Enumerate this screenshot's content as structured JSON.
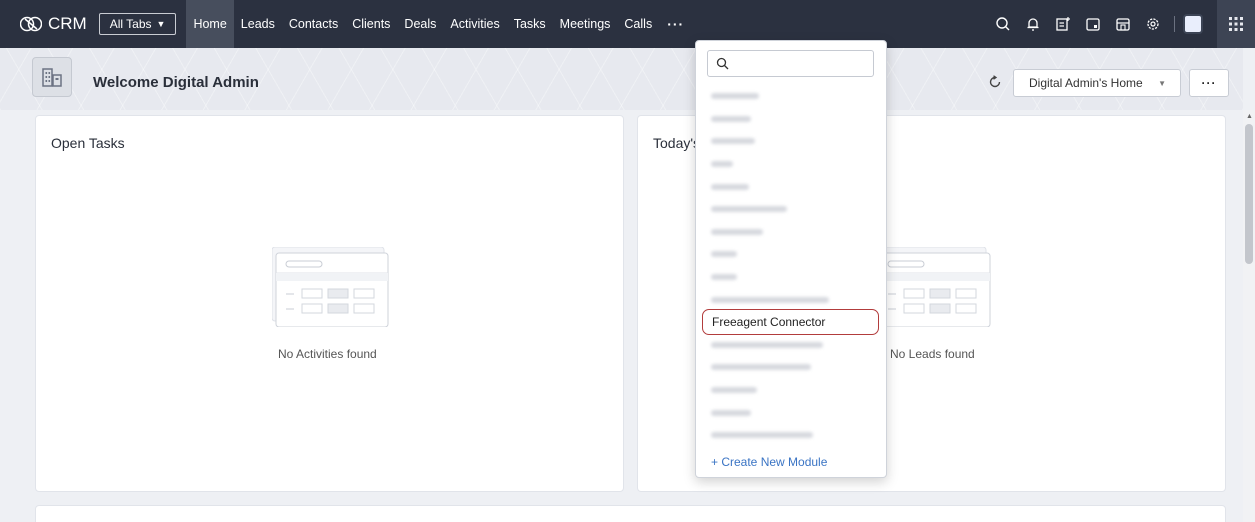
{
  "app": {
    "name": "CRM"
  },
  "nav": {
    "all_tabs_label": "All Tabs",
    "tabs": [
      "Home",
      "Leads",
      "Contacts",
      "Clients",
      "Deals",
      "Activities",
      "Tasks",
      "Meetings",
      "Calls"
    ],
    "active_tab": "Home",
    "more_label": "···",
    "icons": [
      "search-icon",
      "bell-icon",
      "compose-icon",
      "calendar-icon",
      "store-icon",
      "gear-icon",
      "avatar",
      "apps-grid-icon"
    ]
  },
  "header": {
    "welcome_text": "Welcome Digital Admin",
    "home_select_value": "Digital Admin's Home",
    "more_button_label": "···"
  },
  "cards": [
    {
      "title": "Open Tasks",
      "empty_text": "No Activities found"
    },
    {
      "title": "Today's",
      "empty_text": "No Leads found"
    }
  ],
  "dropdown": {
    "search_placeholder": "",
    "highlighted_item": "Freeagent Connector",
    "create_label": "+ Create New Module",
    "blurred_item_count": 15
  },
  "colors": {
    "nav_bg": "#2b3140",
    "active_tab_bg": "#474e5d",
    "highlight_border": "#b23c3c",
    "link": "#3a74c4"
  }
}
